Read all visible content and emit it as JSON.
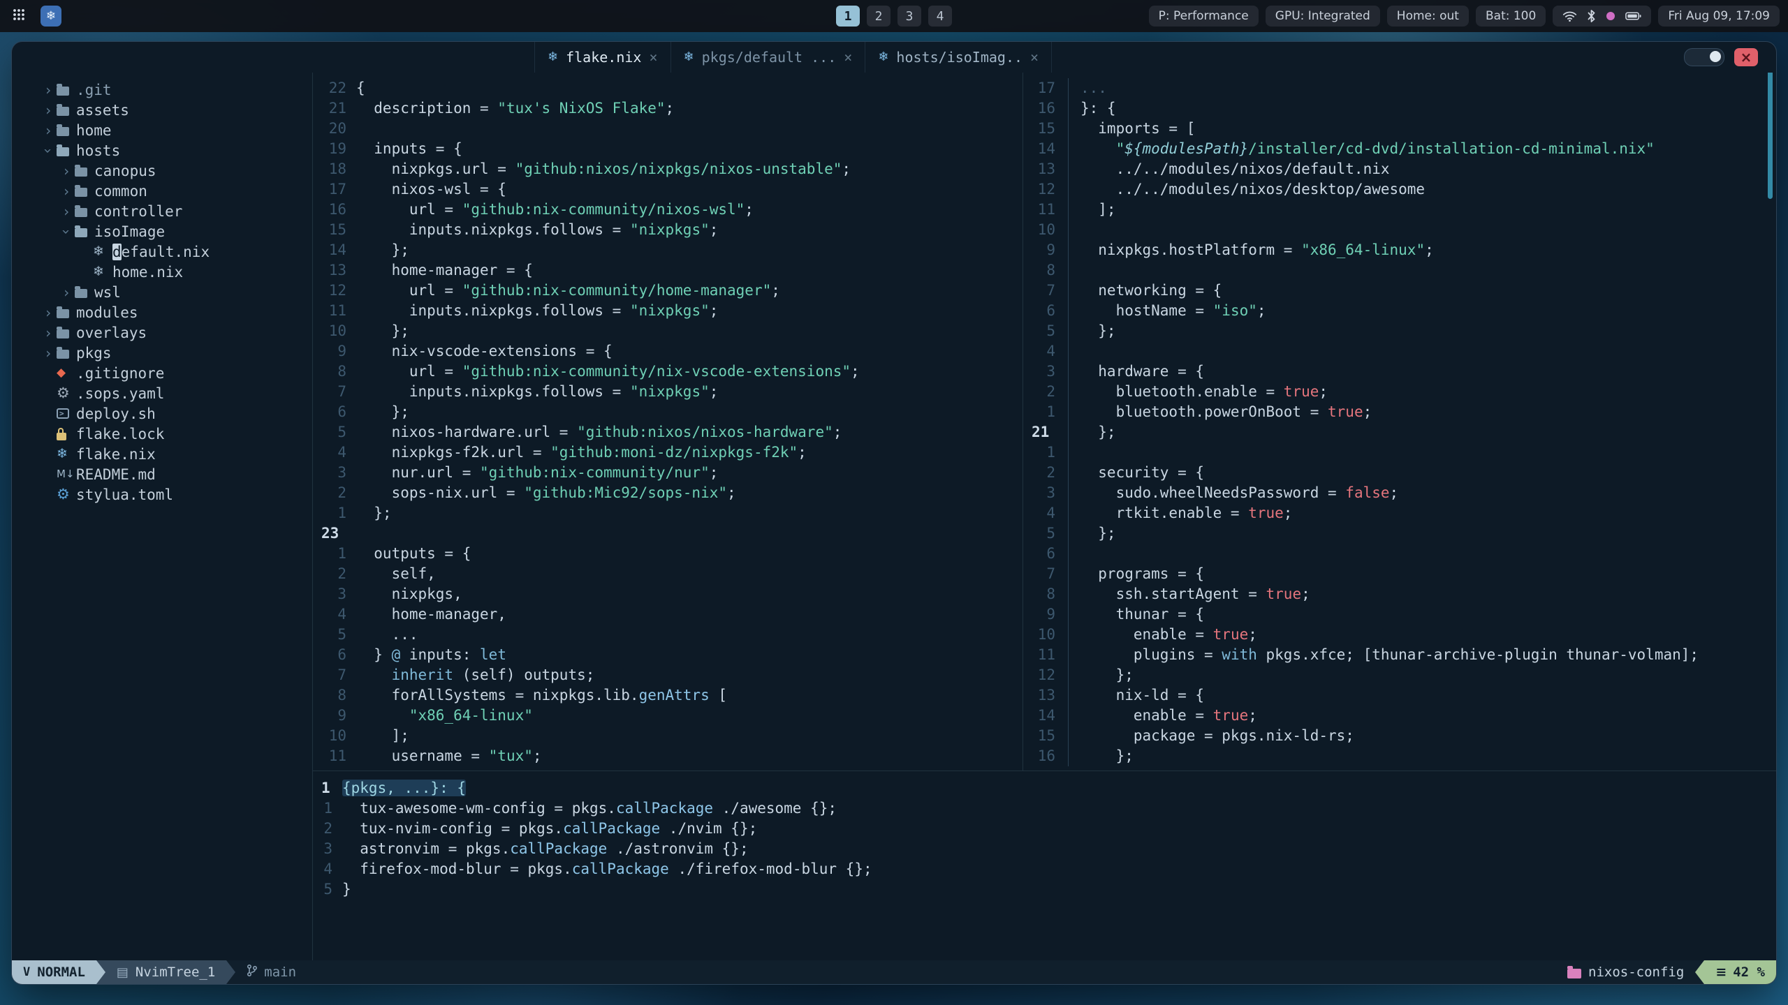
{
  "topbar": {
    "logo_glyph": "❄",
    "workspaces": {
      "items": [
        "1",
        "2",
        "3",
        "4"
      ],
      "active": 0
    },
    "status_widgets": [
      "P: Performance",
      "GPU: Integrated",
      "Home: out",
      "Bat: 100"
    ],
    "tray_icons": [
      "wifi",
      "bluetooth",
      "color-dot",
      "battery"
    ],
    "clock": "Fri Aug 09, 17:09"
  },
  "window": {
    "close_glyph": "×",
    "tabs": [
      {
        "label": "flake.nix",
        "state": "active"
      },
      {
        "label": "pkgs/default ...",
        "state": "inactive"
      },
      {
        "label": "hosts/isoImag..",
        "state": "visible"
      }
    ]
  },
  "tree": {
    "items": [
      {
        "indent": 0,
        "chev": "closed",
        "icon": "folder",
        "label": ".git",
        "dim": true
      },
      {
        "indent": 0,
        "chev": "closed",
        "icon": "folder",
        "label": "assets"
      },
      {
        "indent": 0,
        "chev": "closed",
        "icon": "folder",
        "label": "home"
      },
      {
        "indent": 0,
        "chev": "open",
        "icon": "folder-open",
        "label": "hosts"
      },
      {
        "indent": 1,
        "chev": "closed",
        "icon": "folder",
        "label": "canopus"
      },
      {
        "indent": 1,
        "chev": "closed",
        "icon": "folder",
        "label": "common"
      },
      {
        "indent": 1,
        "chev": "closed",
        "icon": "folder",
        "label": "controller"
      },
      {
        "indent": 1,
        "chev": "open",
        "icon": "folder-open",
        "label": "isoImage"
      },
      {
        "indent": 2,
        "chev": "",
        "icon": "nix",
        "label": "default.nix",
        "cursor": true
      },
      {
        "indent": 2,
        "chev": "",
        "icon": "nix",
        "label": "home.nix"
      },
      {
        "indent": 1,
        "chev": "closed",
        "icon": "folder",
        "label": "wsl"
      },
      {
        "indent": 0,
        "chev": "closed",
        "icon": "folder",
        "label": "modules"
      },
      {
        "indent": 0,
        "chev": "closed",
        "icon": "folder",
        "label": "overlays"
      },
      {
        "indent": 0,
        "chev": "closed",
        "icon": "folder",
        "label": "pkgs"
      },
      {
        "indent": 0,
        "chev": "",
        "icon": "git",
        "label": ".gitignore"
      },
      {
        "indent": 0,
        "chev": "",
        "icon": "gear",
        "label": ".sops.yaml"
      },
      {
        "indent": 0,
        "chev": "",
        "icon": "term",
        "label": "deploy.sh"
      },
      {
        "indent": 0,
        "chev": "",
        "icon": "lock",
        "label": "flake.lock"
      },
      {
        "indent": 0,
        "chev": "",
        "icon": "nix-blue",
        "label": "flake.nix"
      },
      {
        "indent": 0,
        "chev": "",
        "icon": "md",
        "label": "README.md"
      },
      {
        "indent": 0,
        "chev": "",
        "icon": "gear-blue",
        "label": "stylua.toml"
      }
    ]
  },
  "panes": {
    "left": {
      "file": "flake.nix",
      "lines": [
        {
          "n": "22",
          "t": [
            [
              "p",
              "{"
            ]
          ]
        },
        {
          "n": "21",
          "t": [
            [
              "p",
              "  description = "
            ],
            [
              "s",
              "\"tux's NixOS Flake\""
            ],
            [
              "p",
              ";"
            ]
          ]
        },
        {
          "n": "20",
          "t": []
        },
        {
          "n": "19",
          "t": [
            [
              "p",
              "  inputs = {"
            ]
          ]
        },
        {
          "n": "18",
          "t": [
            [
              "p",
              "    nixpkgs.url = "
            ],
            [
              "s",
              "\"github:nixos/nixpkgs/nixos-unstable\""
            ],
            [
              "p",
              ";"
            ]
          ]
        },
        {
          "n": "17",
          "t": [
            [
              "p",
              "    nixos-wsl = {"
            ]
          ]
        },
        {
          "n": "16",
          "t": [
            [
              "p",
              "      url = "
            ],
            [
              "s",
              "\"github:nix-community/nixos-wsl\""
            ],
            [
              "p",
              ";"
            ]
          ]
        },
        {
          "n": "15",
          "t": [
            [
              "p",
              "      inputs.nixpkgs.follows = "
            ],
            [
              "s",
              "\"nixpkgs\""
            ],
            [
              "p",
              ";"
            ]
          ]
        },
        {
          "n": "14",
          "t": [
            [
              "p",
              "    };"
            ]
          ]
        },
        {
          "n": "13",
          "t": [
            [
              "p",
              "    home-manager = {"
            ]
          ]
        },
        {
          "n": "12",
          "t": [
            [
              "p",
              "      url = "
            ],
            [
              "s",
              "\"github:nix-community/home-manager\""
            ],
            [
              "p",
              ";"
            ]
          ]
        },
        {
          "n": "11",
          "t": [
            [
              "p",
              "      inputs.nixpkgs.follows = "
            ],
            [
              "s",
              "\"nixpkgs\""
            ],
            [
              "p",
              ";"
            ]
          ]
        },
        {
          "n": "10",
          "t": [
            [
              "p",
              "    };"
            ]
          ]
        },
        {
          "n": "9",
          "t": [
            [
              "p",
              "    nix-vscode-extensions = {"
            ]
          ]
        },
        {
          "n": "8",
          "t": [
            [
              "p",
              "      url = "
            ],
            [
              "s",
              "\"github:nix-community/nix-vscode-extensions\""
            ],
            [
              "p",
              ";"
            ]
          ]
        },
        {
          "n": "7",
          "t": [
            [
              "p",
              "      inputs.nixpkgs.follows = "
            ],
            [
              "s",
              "\"nixpkgs\""
            ],
            [
              "p",
              ";"
            ]
          ]
        },
        {
          "n": "6",
          "t": [
            [
              "p",
              "    };"
            ]
          ]
        },
        {
          "n": "5",
          "t": [
            [
              "p",
              "    nixos-hardware.url = "
            ],
            [
              "s",
              "\"github:nixos/nixos-hardware\""
            ],
            [
              "p",
              ";"
            ]
          ]
        },
        {
          "n": "4",
          "t": [
            [
              "p",
              "    nixpkgs-f2k.url = "
            ],
            [
              "s",
              "\"github:moni-dz/nixpkgs-f2k\""
            ],
            [
              "p",
              ";"
            ]
          ]
        },
        {
          "n": "3",
          "t": [
            [
              "p",
              "    nur.url = "
            ],
            [
              "s",
              "\"github:nix-community/nur\""
            ],
            [
              "p",
              ";"
            ]
          ]
        },
        {
          "n": "2",
          "t": [
            [
              "p",
              "    sops-nix.url = "
            ],
            [
              "s",
              "\"github:Mic92/sops-nix\""
            ],
            [
              "p",
              ";"
            ]
          ]
        },
        {
          "n": "1",
          "t": [
            [
              "p",
              "  };"
            ]
          ]
        },
        {
          "n": "23",
          "c": true,
          "t": []
        },
        {
          "n": "1",
          "t": [
            [
              "p",
              "  outputs = {"
            ]
          ]
        },
        {
          "n": "2",
          "t": [
            [
              "p",
              "    self,"
            ]
          ]
        },
        {
          "n": "3",
          "t": [
            [
              "p",
              "    nixpkgs,"
            ]
          ]
        },
        {
          "n": "4",
          "t": [
            [
              "p",
              "    home-manager,"
            ]
          ]
        },
        {
          "n": "5",
          "t": [
            [
              "p",
              "    ..."
            ]
          ]
        },
        {
          "n": "6",
          "t": [
            [
              "p",
              "  } "
            ],
            [
              "k",
              "@"
            ],
            [
              "p",
              " inputs: "
            ],
            [
              "k",
              "let"
            ]
          ]
        },
        {
          "n": "7",
          "t": [
            [
              "k",
              "    inherit"
            ],
            [
              "p",
              " (self) outputs;"
            ]
          ]
        },
        {
          "n": "8",
          "t": [
            [
              "p",
              "    forAllSystems = nixpkgs.lib."
            ],
            [
              "fn",
              "genAttrs"
            ],
            [
              "p",
              " ["
            ]
          ]
        },
        {
          "n": "9",
          "t": [
            [
              "s",
              "      \"x86_64-linux\""
            ]
          ]
        },
        {
          "n": "10",
          "t": [
            [
              "p",
              "    ];"
            ]
          ]
        },
        {
          "n": "11",
          "t": [
            [
              "p",
              "    username = "
            ],
            [
              "s",
              "\"tux\""
            ],
            [
              "p",
              ";"
            ]
          ]
        }
      ]
    },
    "right": {
      "file": "hosts/isoImage/default.nix",
      "lines": [
        {
          "n": "17",
          "t": [
            [
              "d",
              "..."
            ]
          ]
        },
        {
          "n": "16",
          "t": [
            [
              "p",
              "}: {"
            ]
          ]
        },
        {
          "n": "15",
          "t": [
            [
              "p",
              "  imports = ["
            ]
          ]
        },
        {
          "n": "14",
          "t": [
            [
              "s",
              "    \""
            ],
            [
              "i",
              "${modulesPath}"
            ],
            [
              "s",
              "/installer/cd-dvd/installation-cd-minimal.nix\""
            ]
          ]
        },
        {
          "n": "13",
          "t": [
            [
              "p",
              "    ../../modules/nixos/default.nix"
            ]
          ]
        },
        {
          "n": "12",
          "t": [
            [
              "p",
              "    ../../modules/nixos/desktop/awesome"
            ]
          ]
        },
        {
          "n": "11",
          "t": [
            [
              "p",
              "  ];"
            ]
          ]
        },
        {
          "n": "10",
          "t": []
        },
        {
          "n": "9",
          "t": [
            [
              "p",
              "  nixpkgs.hostPlatform = "
            ],
            [
              "s",
              "\"x86_64-linux\""
            ],
            [
              "p",
              ";"
            ]
          ]
        },
        {
          "n": "8",
          "t": []
        },
        {
          "n": "7",
          "t": [
            [
              "p",
              "  networking = {"
            ]
          ]
        },
        {
          "n": "6",
          "t": [
            [
              "p",
              "    hostName = "
            ],
            [
              "s",
              "\"iso\""
            ],
            [
              "p",
              ";"
            ]
          ]
        },
        {
          "n": "5",
          "t": [
            [
              "p",
              "  };"
            ]
          ]
        },
        {
          "n": "4",
          "t": []
        },
        {
          "n": "3",
          "t": [
            [
              "p",
              "  hardware = {"
            ]
          ]
        },
        {
          "n": "2",
          "t": [
            [
              "p",
              "    bluetooth.enable = "
            ],
            [
              "b",
              "true"
            ],
            [
              "p",
              ";"
            ]
          ]
        },
        {
          "n": "1",
          "t": [
            [
              "p",
              "    bluetooth.powerOnBoot = "
            ],
            [
              "b",
              "true"
            ],
            [
              "p",
              ";"
            ]
          ]
        },
        {
          "n": "21",
          "c": true,
          "t": [
            [
              "p",
              "  };"
            ]
          ]
        },
        {
          "n": "1",
          "t": []
        },
        {
          "n": "2",
          "t": [
            [
              "p",
              "  security = {"
            ]
          ]
        },
        {
          "n": "3",
          "t": [
            [
              "p",
              "    sudo.wheelNeedsPassword = "
            ],
            [
              "b",
              "false"
            ],
            [
              "p",
              ";"
            ]
          ]
        },
        {
          "n": "4",
          "t": [
            [
              "p",
              "    rtkit.enable = "
            ],
            [
              "b",
              "true"
            ],
            [
              "p",
              ";"
            ]
          ]
        },
        {
          "n": "5",
          "t": [
            [
              "p",
              "  };"
            ]
          ]
        },
        {
          "n": "6",
          "t": []
        },
        {
          "n": "7",
          "t": [
            [
              "p",
              "  programs = {"
            ]
          ]
        },
        {
          "n": "8",
          "t": [
            [
              "p",
              "    ssh.startAgent = "
            ],
            [
              "b",
              "true"
            ],
            [
              "p",
              ";"
            ]
          ]
        },
        {
          "n": "9",
          "t": [
            [
              "p",
              "    thunar = {"
            ]
          ]
        },
        {
          "n": "10",
          "t": [
            [
              "p",
              "      enable = "
            ],
            [
              "b",
              "true"
            ],
            [
              "p",
              ";"
            ]
          ]
        },
        {
          "n": "11",
          "t": [
            [
              "p",
              "      plugins = "
            ],
            [
              "k",
              "with"
            ],
            [
              "p",
              " pkgs.xfce; [thunar-archive-plugin thunar-volman];"
            ]
          ]
        },
        {
          "n": "12",
          "t": [
            [
              "p",
              "    };"
            ]
          ]
        },
        {
          "n": "13",
          "t": [
            [
              "p",
              "    nix-ld = {"
            ]
          ]
        },
        {
          "n": "14",
          "t": [
            [
              "p",
              "      enable = "
            ],
            [
              "b",
              "true"
            ],
            [
              "p",
              ";"
            ]
          ]
        },
        {
          "n": "15",
          "t": [
            [
              "p",
              "      package = pkgs.nix-ld-rs;"
            ]
          ]
        },
        {
          "n": "16",
          "t": [
            [
              "p",
              "    };"
            ]
          ]
        }
      ]
    },
    "bottom": {
      "file": "pkgs/default.nix",
      "lines": [
        {
          "n": "1",
          "c": true,
          "t": [
            [
              "hl",
              "{pkgs, ...}: {"
            ]
          ]
        },
        {
          "n": "1",
          "t": [
            [
              "p",
              "  tux-awesome-wm-config = pkgs."
            ],
            [
              "fn",
              "callPackage"
            ],
            [
              "p",
              " ./awesome {};"
            ]
          ]
        },
        {
          "n": "2",
          "t": [
            [
              "p",
              "  tux-nvim-config = pkgs."
            ],
            [
              "fn",
              "callPackage"
            ],
            [
              "p",
              " ./nvim {};"
            ]
          ]
        },
        {
          "n": "3",
          "t": [
            [
              "p",
              "  astronvim = pkgs."
            ],
            [
              "fn",
              "callPackage"
            ],
            [
              "p",
              " ./astronvim {};"
            ]
          ]
        },
        {
          "n": "4",
          "t": [
            [
              "p",
              "  firefox-mod-blur = pkgs."
            ],
            [
              "fn",
              "callPackage"
            ],
            [
              "p",
              " ./firefox-mod-blur {};"
            ]
          ]
        },
        {
          "n": "5",
          "t": [
            [
              "p",
              "}"
            ]
          ]
        }
      ]
    }
  },
  "statusline": {
    "mode": "NORMAL",
    "buffer": "NvimTree_1",
    "branch": "main",
    "project": "nixos-config",
    "percent": "42 %"
  }
}
